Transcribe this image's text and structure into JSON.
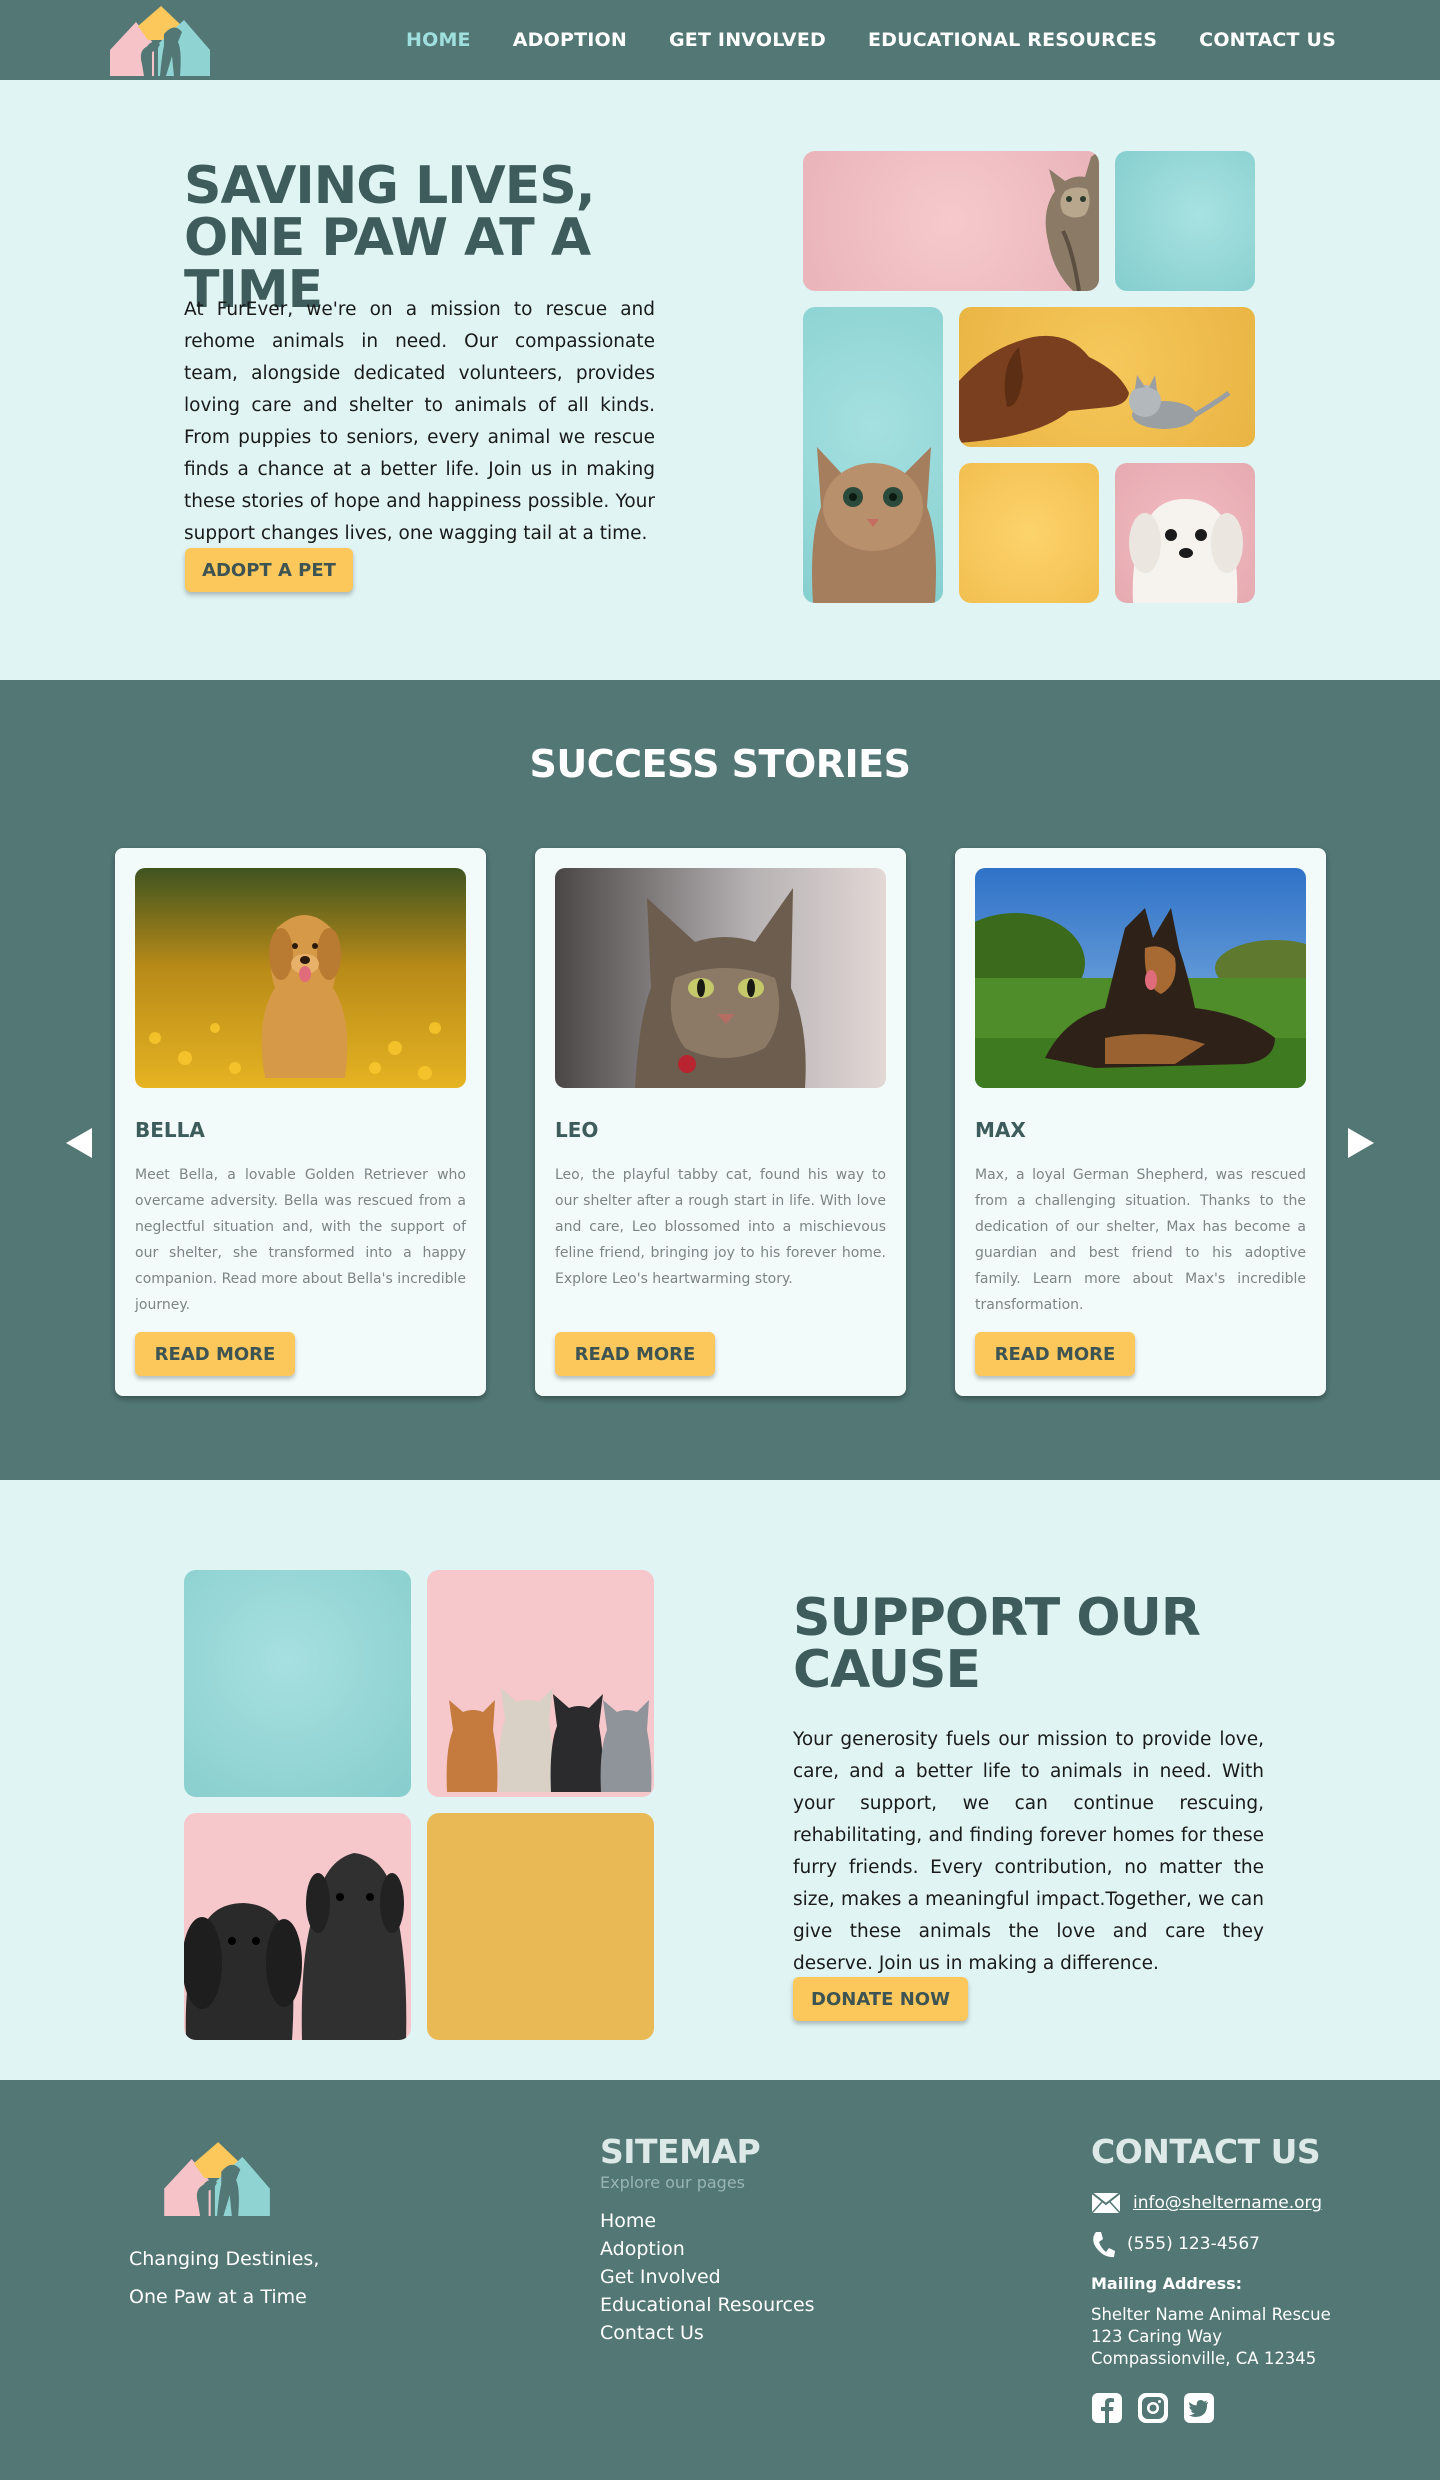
{
  "nav": {
    "links": [
      {
        "label": "HOME",
        "active": true
      },
      {
        "label": "ADOPTION",
        "active": false
      },
      {
        "label": "GET INVOLVED",
        "active": false
      },
      {
        "label": "EDUCATIONAL RESOURCES",
        "active": false
      },
      {
        "label": "CONTACT US",
        "active": false
      }
    ]
  },
  "hero": {
    "title": "SAVING LIVES, ONE PAW AT A TIME",
    "text": "At FurEver, we're on a mission to rescue and rehome animals in need. Our compassionate team, alongside dedicated volunteers, provides loving care and shelter to animals of all kinds. From puppies to seniors, every animal we rescue finds a chance at a better life. Join us in making these stories of hope and happiness possible. Your support changes lives, one wagging tail at a time.",
    "button": "ADOPT A PET"
  },
  "stories": {
    "title": "SUCCESS STORIES",
    "cards": [
      {
        "name": "BELLA",
        "text": "Meet Bella, a lovable Golden Retriever who overcame adversity. Bella was rescued from a neglectful situation and, with the support of our shelter, she transformed into a happy companion. Read more about Bella's incredible journey.",
        "button": "READ MORE"
      },
      {
        "name": "LEO",
        "text": "Leo, the playful tabby cat, found his way to our shelter after a rough start in life. With love and care, Leo blossomed into a mischievous feline friend, bringing joy to his forever home. Explore Leo's heartwarming story.",
        "button": "READ MORE"
      },
      {
        "name": "MAX",
        "text": "Max, a loyal German Shepherd, was rescued from a challenging situation. Thanks to the dedication of our shelter, Max has become a guardian and best friend to his adoptive family. Learn more about Max's incredible transformation.",
        "button": "READ MORE"
      }
    ]
  },
  "support": {
    "title": "SUPPORT OUR CAUSE",
    "text": "Your generosity fuels our mission to provide love, care, and a better life to animals in need. With your support, we can continue rescuing, rehabilitating, and finding forever homes for these furry friends. Every contribution, no matter the size, makes a meaningful impact.Together, we can give these animals the love and care they deserve. Join us in making a difference.",
    "button": "DONATE NOW"
  },
  "footer": {
    "tagline_line1": "Changing Destinies,",
    "tagline_line2": "One Paw at a Time",
    "sitemap_title": "SITEMAP",
    "sitemap_subtitle": "Explore our pages",
    "sitemap_links": [
      "Home",
      "Adoption",
      "Get Involved",
      "Educational Resources",
      "Contact Us"
    ],
    "contact_title": "CONTACT US",
    "email": "info@sheltername.org",
    "phone": "(555) 123-4567",
    "mailing_label": "Mailing Address:",
    "address_line1": "Shelter Name Animal Rescue",
    "address_line2": "123 Caring Way",
    "address_line3": "Compassionville, CA 12345",
    "social_icons": [
      "facebook-icon",
      "instagram-icon",
      "twitter-icon"
    ]
  },
  "colors": {
    "teal_dark": "#527775",
    "teal_light": "#dff4f3",
    "aqua": "#8fd3d3",
    "pink": "#f4c2c6",
    "yellow": "#fcc85b",
    "heading": "#3d5c5b"
  }
}
